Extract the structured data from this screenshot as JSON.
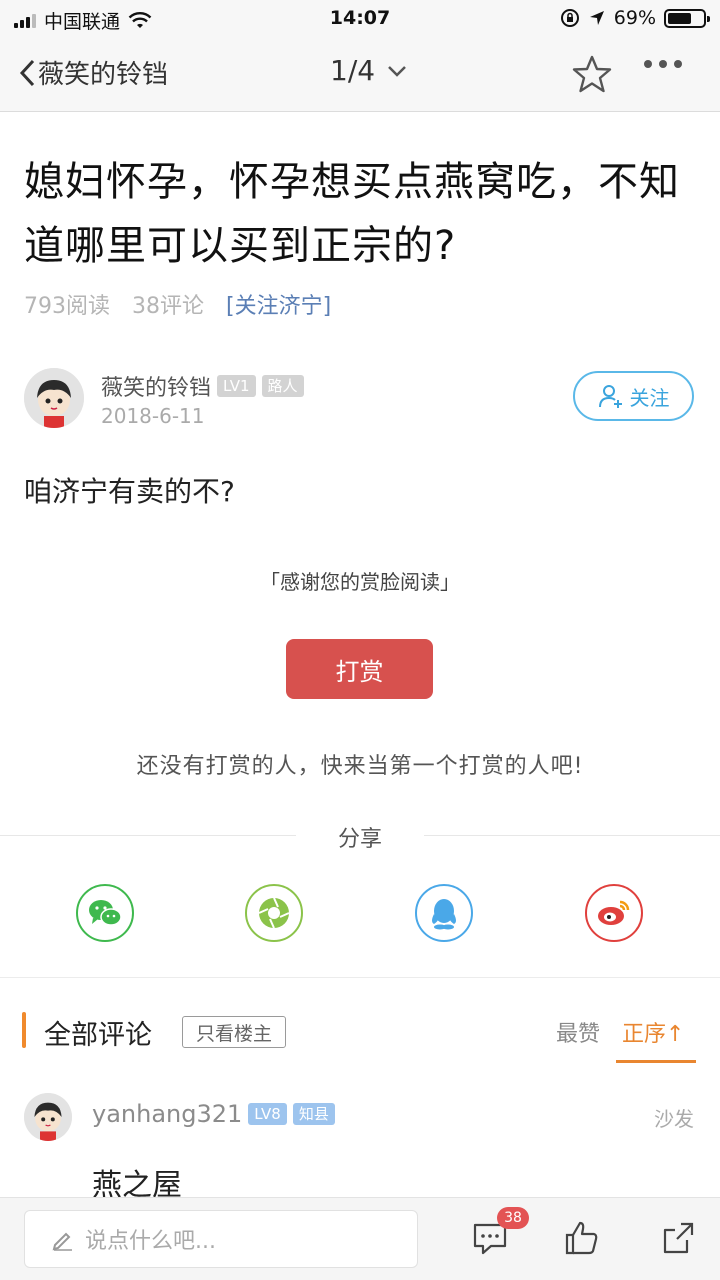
{
  "status_bar": {
    "carrier": "中国联通",
    "time": "14:07",
    "battery_percent": "69%",
    "battery_level": 0.69
  },
  "nav": {
    "back_label": "薇笑的铃铛",
    "page_indicator": "1/4"
  },
  "post": {
    "title": "媳妇怀孕，怀孕想买点燕窝吃，不知道哪里可以买到正宗的?",
    "views": "793阅读",
    "comments": "38评论",
    "forum_tag": "[关注济宁]",
    "author": {
      "name": "薇笑的铃铛",
      "level": "LV1",
      "rank": "路人",
      "date": "2018-6-11"
    },
    "follow_label": "关注",
    "content": "咱济宁有卖的不?"
  },
  "reward": {
    "thanks": "「感谢您的赏脸阅读」",
    "button": "打赏",
    "none_text": "还没有打赏的人，快来当第一个打赏的人吧!"
  },
  "share": {
    "label": "分享",
    "icons": [
      "wechat-icon",
      "moments-icon",
      "qq-icon",
      "weibo-icon"
    ],
    "colors": [
      "#3fb94e",
      "#8bc34a",
      "#4aa8e8",
      "#e0403d"
    ]
  },
  "comments": {
    "title": "全部评论",
    "only_host": "只看楼主",
    "sort_best": "最赞",
    "sort_asc": "正序↑",
    "items": [
      {
        "user": "yanhang321",
        "level": "LV8",
        "rank": "知县",
        "floor": "沙发",
        "text": "燕之屋"
      }
    ]
  },
  "bottom": {
    "placeholder": "说点什么吧...",
    "comment_count": "38"
  },
  "colors": {
    "accent_orange": "#e98630",
    "reward_red": "#d7514e",
    "follow_blue": "#3aa4dd",
    "tag_blue": "#5b7fb5"
  }
}
